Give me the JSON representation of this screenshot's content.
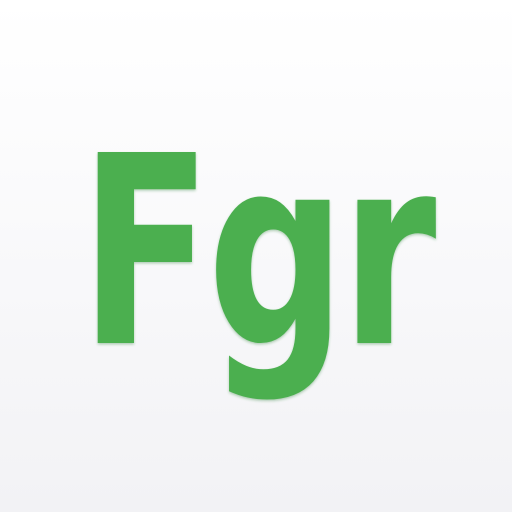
{
  "logo": {
    "text": "Fgr",
    "color": "#4caf50",
    "shadow_color": "#2e7d32"
  },
  "background": {
    "top_color": "#ffffff",
    "bottom_color": "#f2f2f5"
  }
}
